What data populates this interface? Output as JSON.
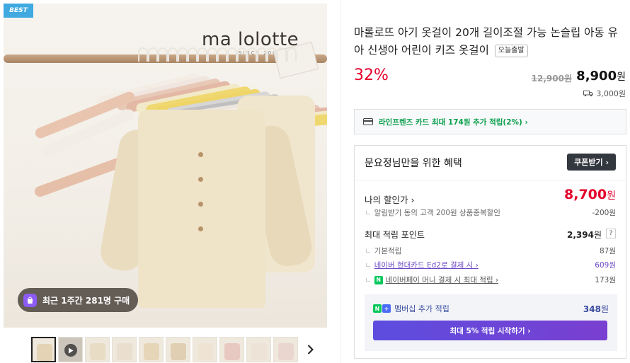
{
  "image": {
    "badge": "BEST",
    "brand": "ma lolotte",
    "brand_since": "SINCE 2006",
    "recent_purchase": "최근 1주간 281명 구매"
  },
  "thumbnails": {
    "count": 10,
    "next_icon": "chevron-right"
  },
  "product": {
    "title": "마롤로뜨 아기 옷걸이 20개 길이조절 가능 논슬립 아동 유아 신생아 어린이 키즈 옷걸이",
    "delivery_tag": "오늘출발",
    "discount_rate": "32%",
    "original_price": "12,900원",
    "sale_price": "8,900",
    "sale_price_unit": "원",
    "shipping_fee": "3,000원"
  },
  "card_benefit": {
    "text": "라인프렌즈 카드 최대 174원 추가 적립(2%) ›"
  },
  "benefits": {
    "header": "문요정님만을 위한 혜택",
    "coupon_button": "쿠폰받기 ›",
    "my_discount_label": "나의 할인가 ›",
    "my_discount_value": "8,700",
    "my_discount_unit": "원",
    "alarm_discount_label": "알림받기 동의 고객 200원 상품중복할인",
    "alarm_discount_value": "-200원",
    "points_label": "최대 적립 포인트",
    "points_value": "2,394",
    "points_unit": "원",
    "points_help": "?",
    "basic_label": "기본적립",
    "basic_value": "87원",
    "hyundai_label": "네이버 현대카드 Ed2로 결제 시 ›",
    "hyundai_value": "609원",
    "npay_label": "네이버페이 머니 결제 시 최대 적립 ›",
    "npay_value": "173원",
    "membership_label": "멤버십 추가 적립",
    "membership_value": "348",
    "membership_unit": "원",
    "membership_button": "최대 5% 적립 시작하기 ›"
  },
  "colors": {
    "accent_red": "#e4002b",
    "naver_green": "#03c75a",
    "membership_purple": "#6e4ac8",
    "best_badge": "#40a9e0"
  }
}
